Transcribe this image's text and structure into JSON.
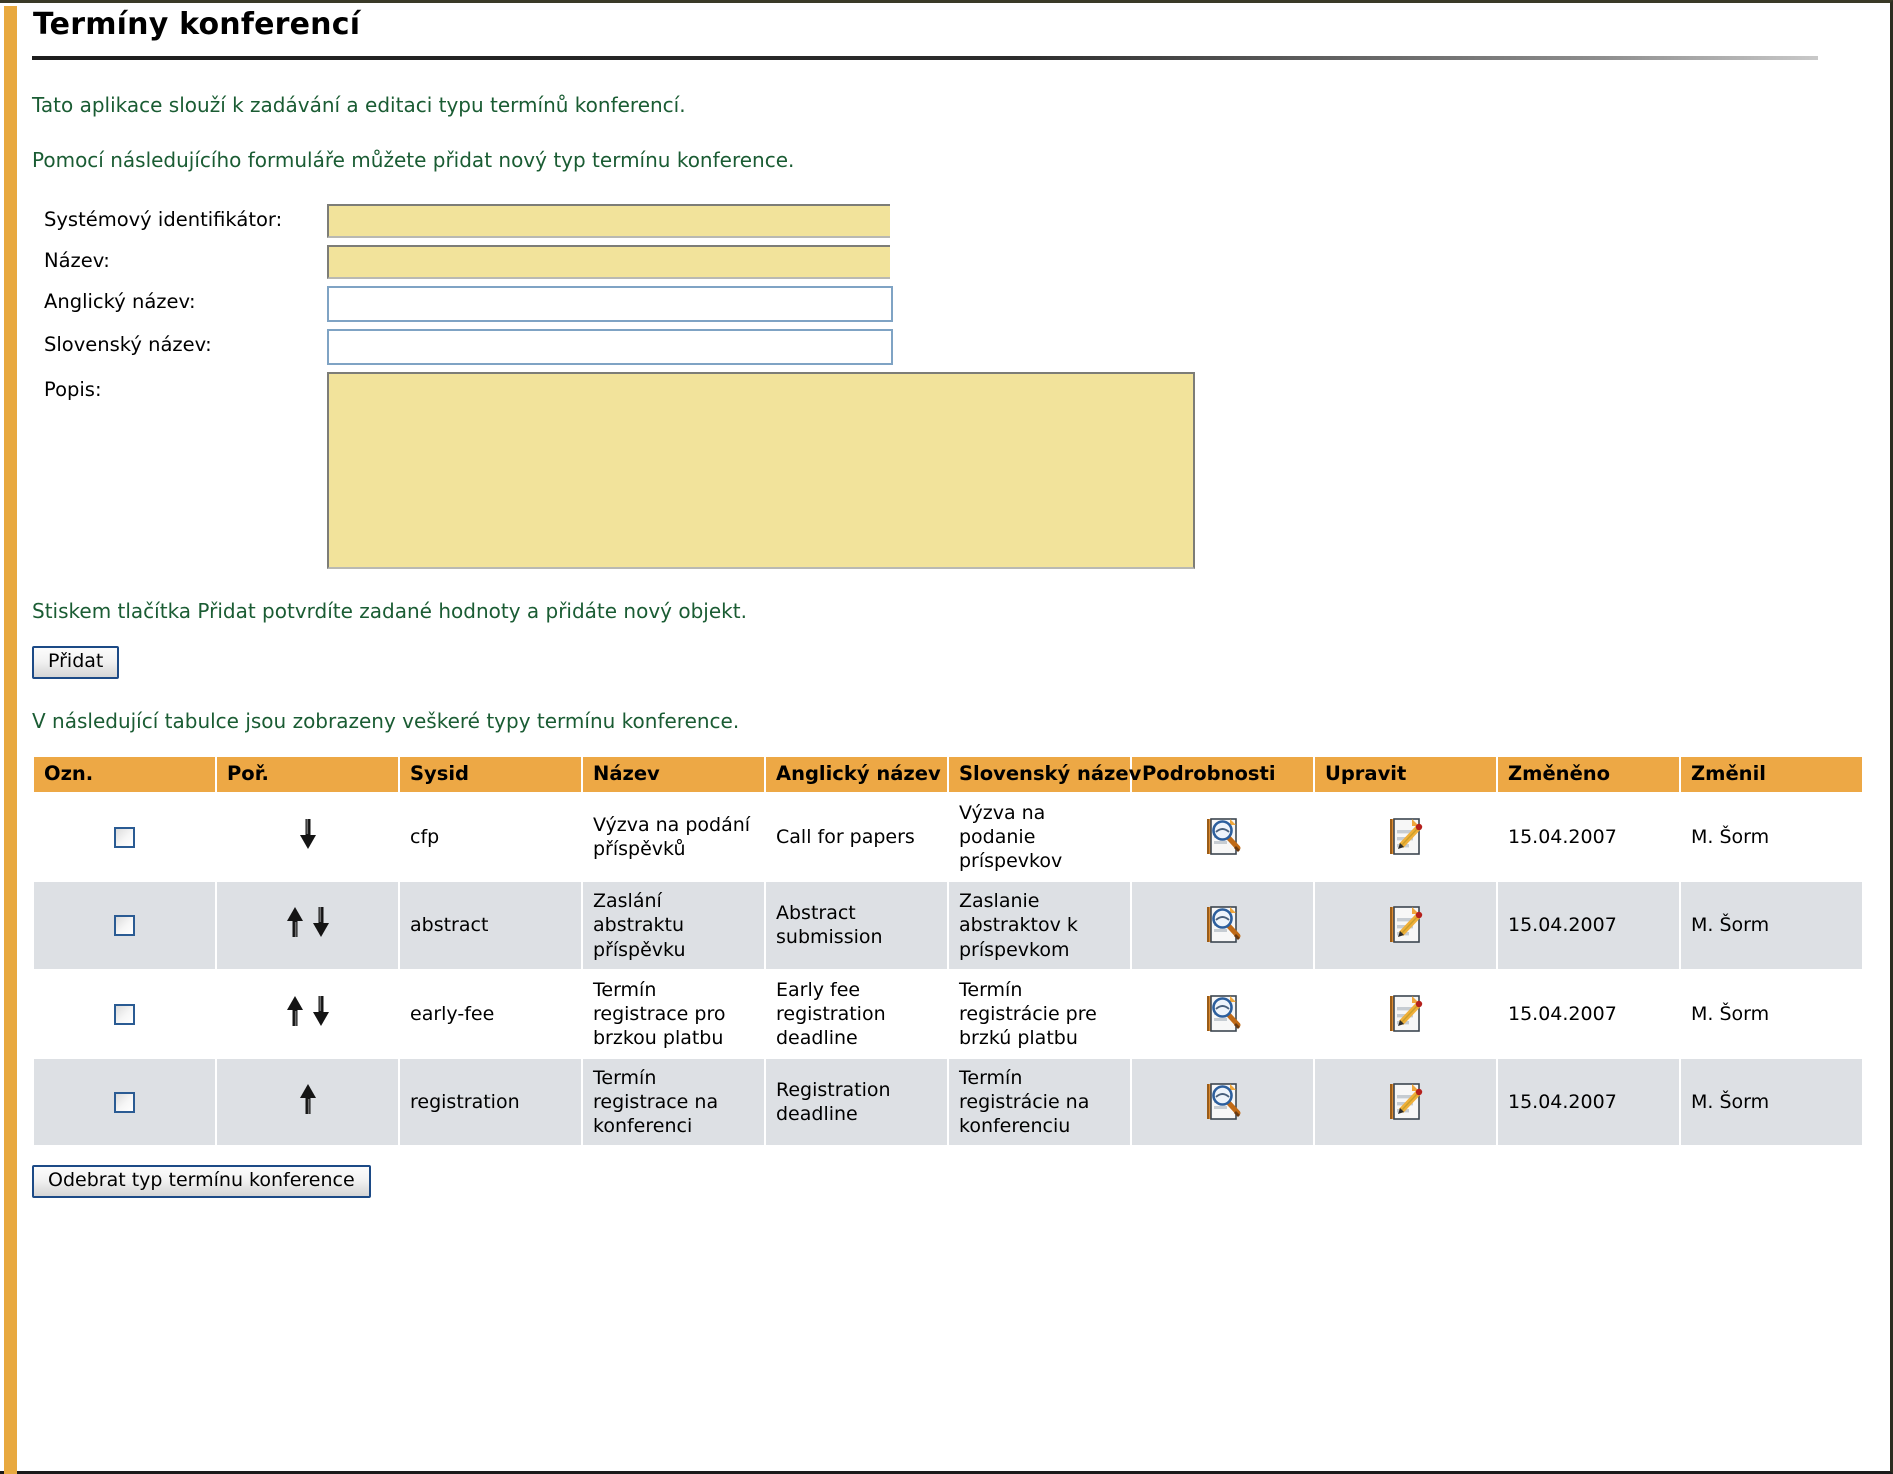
{
  "page": {
    "title": "Termíny konferencí",
    "intro_1": "Tato aplikace slouží k zadávání a editaci typu termínů konferencí.",
    "intro_2": "Pomocí následujícího formuláře můžete přidat nový typ termínu konference.",
    "note_submit": "Stiskem tlačítka Přidat potvrdíte zadané hodnoty a přidáte nový objekt.",
    "note_table": "V následující tabulce jsou zobrazeny veškeré typy termínu konference."
  },
  "colors": {
    "accent_orange": "#eda845",
    "left_stripe": "#e8a93f",
    "intro_green": "#1a5c33",
    "required_field_bg": "#f2e39b",
    "optional_field_border": "#7fa3c4",
    "row_alt_bg": "#dde0e4",
    "user_link": "#b0441a",
    "button_border": "#1c4a86"
  },
  "form": {
    "fields": [
      {
        "label": "Systémový identifikátor:",
        "value": "",
        "placeholder": "",
        "kind": "required",
        "name": "sysid-field"
      },
      {
        "label": "Název:",
        "value": "",
        "placeholder": "",
        "kind": "required",
        "name": "nazev-field"
      },
      {
        "label": "Anglický název:",
        "value": "",
        "placeholder": "",
        "kind": "optional",
        "name": "anglicky-nazev-field"
      },
      {
        "label": "Slovenský název:",
        "value": "",
        "placeholder": "",
        "kind": "optional",
        "name": "slovensky-nazev-field"
      },
      {
        "label": "Popis:",
        "value": "",
        "placeholder": "",
        "kind": "textarea",
        "name": "popis-field"
      }
    ],
    "submit_label": "Přidat"
  },
  "table": {
    "columns": [
      "Ozn.",
      "Poř.",
      "Sysid",
      "Název",
      "Anglický název",
      "Slovenský název",
      "Podrobnosti",
      "Upravit",
      "Změněno",
      "Změnil"
    ],
    "rows": [
      {
        "checked": false,
        "order_icons": [
          "down"
        ],
        "sysid": "cfp",
        "nazev": "Výzva na podání příspěvků",
        "anglicky": "Call for papers",
        "slovensky": "Výzva na podanie príspevkov",
        "details_icon": "document-magnifier-icon",
        "edit_icon": "document-pencil-icon",
        "zmeneno": "15.04.2007",
        "zmenil": "M. Šorm"
      },
      {
        "checked": false,
        "order_icons": [
          "up",
          "down"
        ],
        "sysid": "abstract",
        "nazev": "Zaslání abstraktu příspěvku",
        "anglicky": "Abstract submission",
        "slovensky": "Zaslanie abstraktov k príspevkom",
        "details_icon": "document-magnifier-icon",
        "edit_icon": "document-pencil-icon",
        "zmeneno": "15.04.2007",
        "zmenil": "M. Šorm"
      },
      {
        "checked": false,
        "order_icons": [
          "up",
          "down"
        ],
        "sysid": "early-fee",
        "nazev": "Termín registrace pro brzkou platbu",
        "anglicky": "Early fee registration deadline",
        "slovensky": "Termín registrácie pre brzkú platbu",
        "details_icon": "document-magnifier-icon",
        "edit_icon": "document-pencil-icon",
        "zmeneno": "15.04.2007",
        "zmenil": "M. Šorm"
      },
      {
        "checked": false,
        "order_icons": [
          "up"
        ],
        "sysid": "registration",
        "nazev": "Termín registrace na konferenci",
        "anglicky": "Registration deadline",
        "slovensky": "Termín registrácie na konferenciu",
        "details_icon": "document-magnifier-icon",
        "edit_icon": "document-pencil-icon",
        "zmeneno": "15.04.2007",
        "zmenil": "M. Šorm"
      }
    ]
  },
  "actions": {
    "remove_label": "Odebrat typ termínu konference"
  }
}
